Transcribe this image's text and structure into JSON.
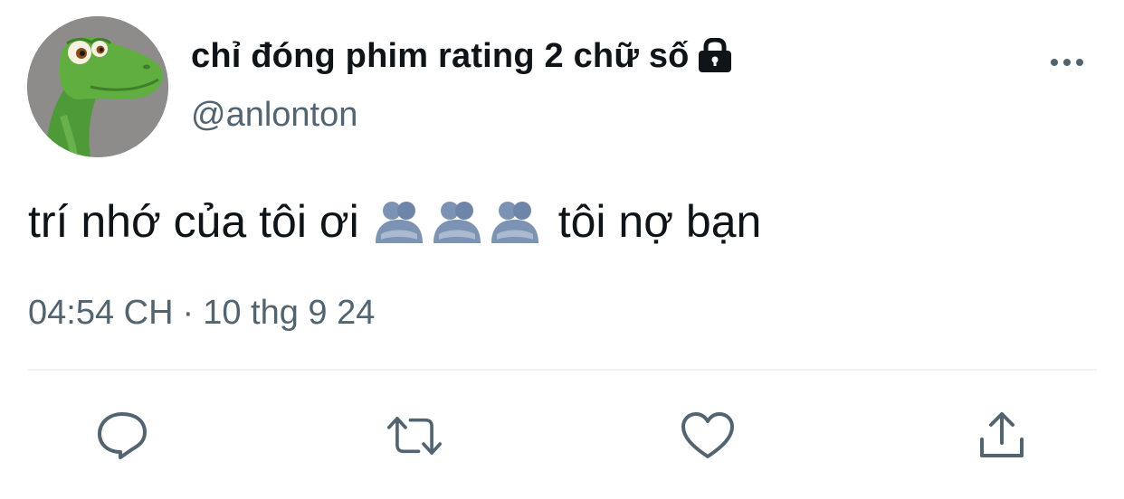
{
  "user": {
    "display_name": "chỉ đóng phim rating 2 chữ số",
    "handle": "@anlonton",
    "protected": true,
    "avatar": "dinosaur-avatar"
  },
  "tweet": {
    "text_before": "trí nhớ của tôi ơi",
    "emoji": [
      "hugging-people-emoji",
      "hugging-people-emoji",
      "hugging-people-emoji"
    ],
    "text_after": "tôi nợ bạn",
    "time": "04:54 CH",
    "separator": "·",
    "date": "10 thg 9 24"
  },
  "actions": [
    "reply-icon",
    "retweet-icon",
    "like-icon",
    "share-icon"
  ],
  "colors": {
    "text": "#0f1419",
    "secondary": "#536471",
    "divider": "#eff3f4",
    "icon": "#536471"
  }
}
